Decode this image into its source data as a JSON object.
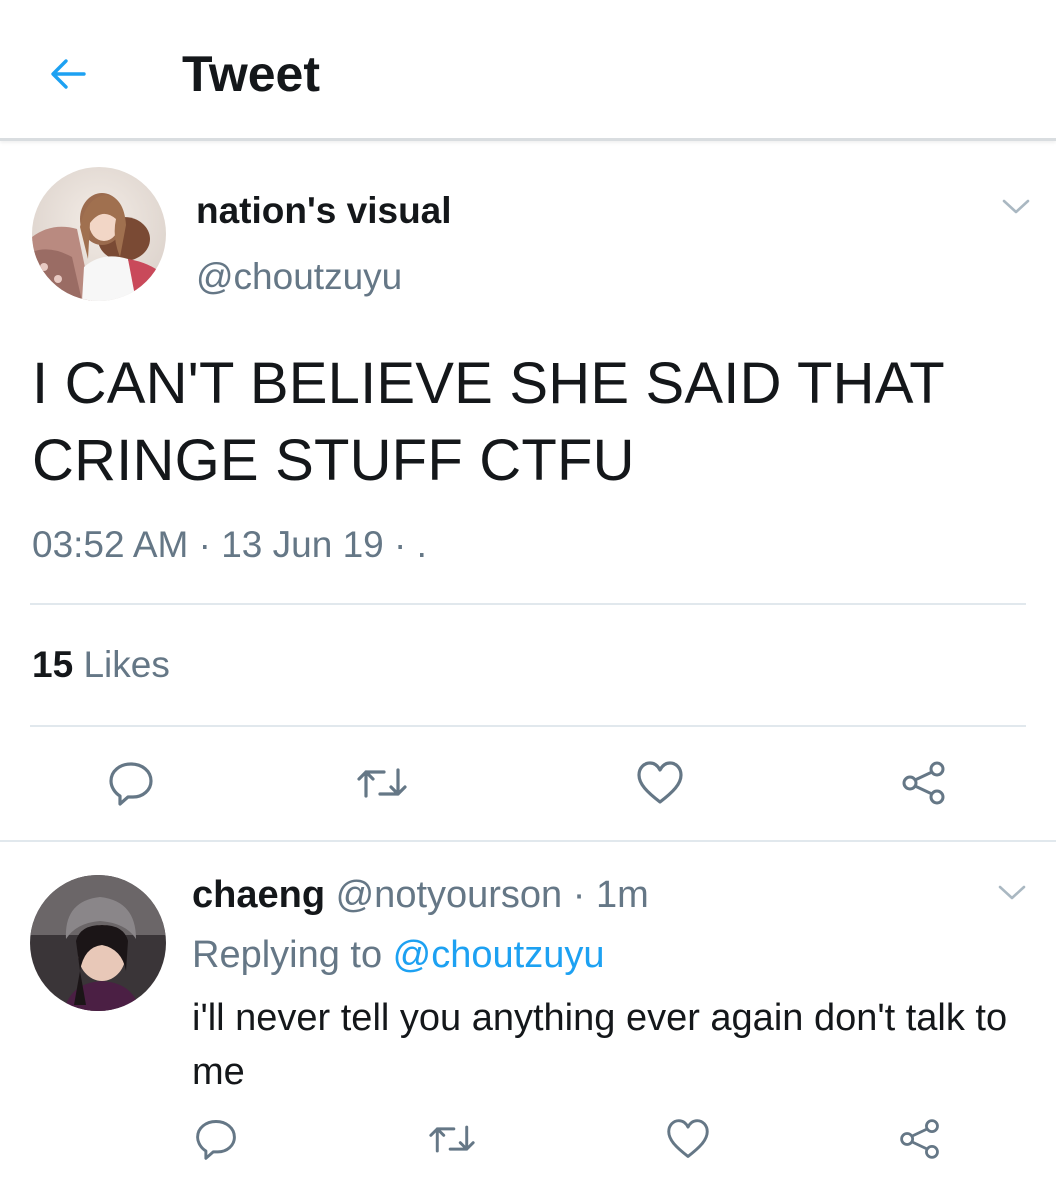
{
  "header": {
    "title": "Tweet",
    "back_icon": "arrow-left-icon",
    "accent_color": "#1da1f2"
  },
  "tweet": {
    "display_name": "nation's visual",
    "handle": "@choutzuyu",
    "text": "I CAN'T BELIEVE SHE SAID THAT CRINGE STUFF CTFU",
    "timestamp": "03:52 AM · 13 Jun 19 · .",
    "likes_count": "15",
    "likes_label": "Likes",
    "actions": [
      "reply-icon",
      "retweet-icon",
      "like-icon",
      "share-icon"
    ]
  },
  "reply": {
    "display_name": "chaeng",
    "meta": " @notyourson · 1m",
    "replying_prefix": "Replying to ",
    "replying_to": "@choutzuyu",
    "text": "i'll never tell you anything ever again don't talk to me",
    "actions": [
      "reply-icon",
      "retweet-icon",
      "like-icon",
      "share-icon"
    ]
  },
  "colors": {
    "text": "#14171a",
    "secondary": "#657786",
    "link": "#1da1f2",
    "divider": "#e1e8ed"
  }
}
